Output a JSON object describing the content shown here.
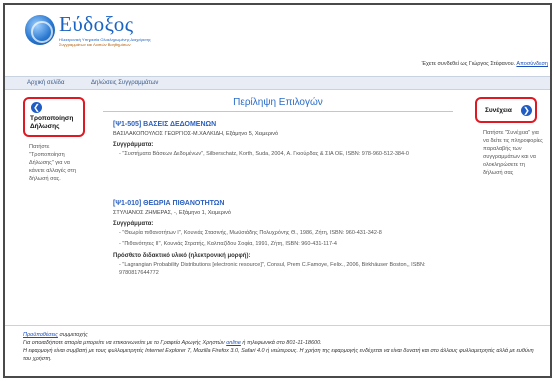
{
  "header": {
    "logo_text": "Εύδοξος",
    "logo_sub1": "Ηλεκτρονική Υπηρεσία Ολοκληρωμένης Διαχείρισης",
    "logo_sub2": "Συγγραμμάτων και Λοιπών Βοηθημάτων",
    "login_prefix": "Έχετε συνδεθεί ως Γιώργος Στέφανου.",
    "logout_link": "Αποσύνδεση"
  },
  "nav": {
    "home": "Αρχική σελίδα",
    "requests": "Δηλώσεις Συγγραμμάτων"
  },
  "left": {
    "back_label": "Τροποποίηση Δήλωσης",
    "help": "Πατήστε \"Τροποποίηση Δήλωσης\" για να κάνετε αλλαγές στη δήλωσή σας."
  },
  "main": {
    "title": "Περίληψη Επιλογών",
    "courses": [
      {
        "title": "[Ψ1-505] ΒΑΣΕΙΣ ΔΕΔΟΜΕΝΩΝ",
        "teachers": "ΒΑΣΙΛΑΚΟΠΟΥΛΟΣ ΓΕΩΡΓΙΟΣ-Μ.ΧΑΛΚΙΔΗ, Εξάμηνο 5, Χειμερινό",
        "books_head": "Συγγράμματα:",
        "books": [
          "\"Συστήματα Βάσεων Δεδομένων\", Silberschatz, Korth, Suda, 2004, Α. Γκιούρδας & ΣΙΑ ΟΕ, ISBN: 978-960-512-384-0"
        ]
      },
      {
        "title": "[Ψ1-010] ΘΕΩΡΙΑ ΠΙΘΑΝΟΤΗΤΩΝ",
        "teachers": "ΣΤΥΛΙΑΝΟΣ ΖΗΜΕΡΑΣ, -, Εξάμηνο 1, Χειμερινό",
        "books_head": "Συγγράμματα:",
        "books": [
          "\"Θεωρία πιθανοτήτων I\", Κουνιάς Στασινής, Μωϋσιάδης Πολυχρόνης Θ., 1986, Ζήτη, ISBN: 960-431-342-8",
          "\"Πιθανότητες II\", Κουνιάς Στρατής, Καλπαζίδου Σοφία, 1991, Ζήτη, ISBN: 960-431-117-4"
        ],
        "extra_head": "Πρόσθετο διδακτικό υλικό (ηλεκτρονική μορφή):",
        "extra": "\"Lagrangian Probability Distributions [electronic resource]\", Consul, Prem C.Famoye, Felix., 2006, Birkhäuser Boston,, ISBN: 9780817644772"
      }
    ]
  },
  "right": {
    "next_label": "Συνέχεια",
    "help": "Πατήστε \"Συνέχεια\" για να δείτε τις πληροφορίες παραλαβής των συγγραμμάτων και να ολοκληρώσετε τη δήλωσή σας"
  },
  "footer": {
    "terms_link": "Προϋποθέσεις",
    "terms_rest": " συμμετοχής",
    "line2_prefix": "Για οποιαδήποτε απορία μπορείτε να επικοινωνείτε με το Γραφείο Αρωγής Χρηστών ",
    "online_link": "online",
    "line2_suffix": " ή τηλεφωνικά στο 801-11-18600.",
    "line3": "Η εφαρμογή είναι συμβατή με τους φυλλομετρητές Internet Explorer 7, Mozilla Firefox 3.0, Safari 4.0 ή νεώτερους. Η χρήση της εφαρμογής ενδέχεται να είναι δυνατή και στο άλλους φυλλομετρητές αλλά με ευθύνη του χρήστη."
  },
  "colors": {
    "accent_blue": "#2a6cc8",
    "highlight_red": "#e01822",
    "nav_bg": "#e8edf5"
  },
  "icons": {
    "back": "arrow-left-circle-icon",
    "next": "arrow-right-circle-icon",
    "logo": "globe-logo-icon"
  }
}
